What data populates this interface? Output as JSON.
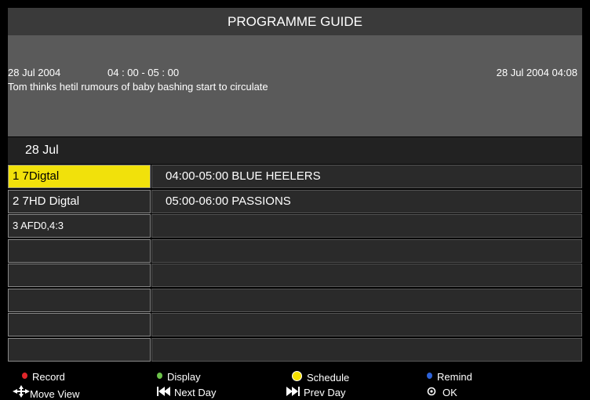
{
  "header": {
    "title": "PROGRAMME GUIDE"
  },
  "info": {
    "date": "28  Jul  2004",
    "time": "04 : 00 - 05 : 00",
    "now": "28  Jul  2004  04:08",
    "description": "Tom  thinks      hetil  rumours     of  baby  bashing     start    to  circulate"
  },
  "day_label": "28 Jul",
  "channels": [
    {
      "label": "1  7Digtal",
      "selected": true
    },
    {
      "label": "2  7HD Digtal"
    },
    {
      "label": "3  AFD0,4:3"
    },
    {
      "label": ""
    },
    {
      "label": ""
    },
    {
      "label": ""
    },
    {
      "label": ""
    },
    {
      "label": ""
    }
  ],
  "programmes": [
    {
      "label": "04:00-05:00 BLUE HEELERS"
    },
    {
      "label": "05:00-06:00 PASSIONS"
    },
    {
      "label": ""
    },
    {
      "label": ""
    },
    {
      "label": ""
    },
    {
      "label": ""
    },
    {
      "label": ""
    },
    {
      "label": ""
    }
  ],
  "legend": {
    "record": "Record",
    "record_color": "#e0262a",
    "display": "Display",
    "display_color": "#6cc24a",
    "schedule": "Schedule",
    "schedule_color": "#f5e000",
    "remind": "Remind",
    "remind_color": "#2d62d8",
    "move_view": "Move View",
    "move_icon": "arrows-icon",
    "next_day": "Next Day",
    "next_icon": "skip-back-icon",
    "prev_day": "Prev Day",
    "prev_icon": "fast-forward-icon",
    "ok": "OK",
    "ok_icon": "ok-icon"
  }
}
